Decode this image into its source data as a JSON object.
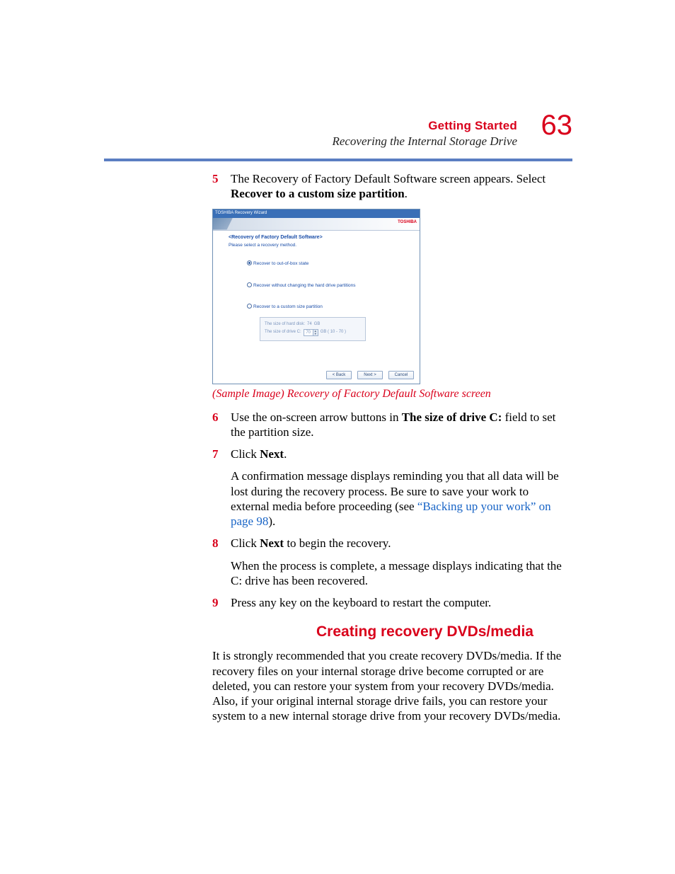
{
  "header": {
    "chapter": "Getting Started",
    "subtitle": "Recovering the Internal Storage Drive",
    "page_number": "63"
  },
  "dialog": {
    "title": "TOSHIBA Recovery Wizard",
    "ribbon_right": "TOSHIBA",
    "heading": "<Recovery of Factory Default Software>",
    "instruction": "Please select a recovery method.",
    "options": {
      "opt1": "Recover to out-of-box state",
      "opt2": "Recover without changing the hard drive partitions",
      "opt3": "Recover to a custom size partition"
    },
    "drive_panel": {
      "row1_label": "The size of hard disk:",
      "row1_value": "74",
      "row1_unit": "GB",
      "row2_label": "The size of drive C:",
      "row2_value": "70",
      "row2_suffix": "GB ( 10 - 70 )"
    },
    "buttons": {
      "back": "< Back",
      "next": "Next >",
      "cancel": "Cancel"
    }
  },
  "caption": "(Sample Image) Recovery of Factory Default Software screen",
  "steps": {
    "s5_num": "5",
    "s5_a": "The Recovery of Factory Default Software screen appears. Select ",
    "s5_bold": "Recover to a custom size partition",
    "s5_b": ".",
    "s6_num": "6",
    "s6_a": "Use the on-screen arrow buttons in ",
    "s6_bold": "The size of drive C:",
    "s6_b": " field to set the partition size.",
    "s7_num": "7",
    "s7_a": "Click ",
    "s7_bold": "Next",
    "s7_b": ".",
    "s7_p2a": "A confirmation message displays reminding you that all data will be lost during the recovery process. Be sure to save your work to external media before proceeding (see ",
    "s7_p2_link": "“Backing up your work” on page 98",
    "s7_p2b": ").",
    "s8_num": "8",
    "s8_a": "Click ",
    "s8_bold": "Next",
    "s8_b": " to begin the recovery.",
    "s8_p2": "When the process is complete, a message displays indicating that the C: drive has been recovered.",
    "s9_num": "9",
    "s9_a": "Press any key on the keyboard to restart the computer."
  },
  "section": {
    "heading": "Creating recovery DVDs/media",
    "para": "It is strongly recommended that you create recovery DVDs/media. If the recovery files on your internal storage drive become corrupted or are deleted, you can restore your system from your recovery DVDs/media. Also, if your original internal storage drive fails, you can restore your system to a new internal storage drive from your recovery DVDs/media."
  }
}
